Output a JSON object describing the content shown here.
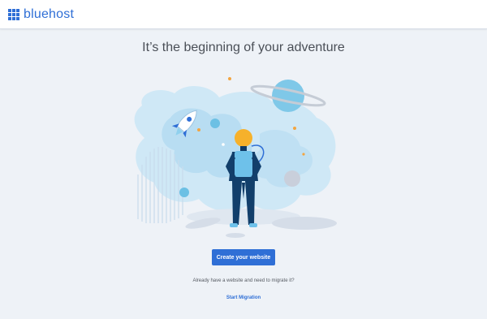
{
  "header": {
    "brand": "bluehost",
    "logo_icon": "bluehost-grid-logo",
    "brand_color": "#2f6fd6"
  },
  "main": {
    "headline": "It’s the beginning of your adventure",
    "illustration_icon": "astronaut-space-illustration",
    "primary_button": "Create your website",
    "migrate_prompt": "Already have a website and need to migrate it?",
    "migrate_link": "Start Migration"
  },
  "colors": {
    "background": "#eef2f7",
    "accent": "#2f6fd6",
    "text": "#4a4f57"
  }
}
